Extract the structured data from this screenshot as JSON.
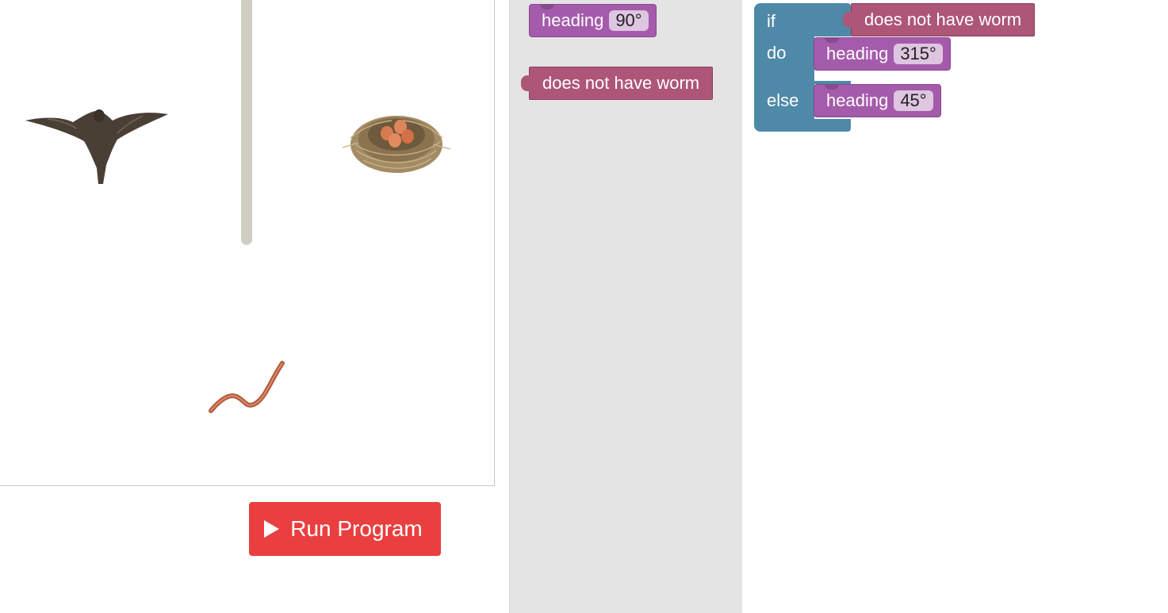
{
  "maze": {
    "bird_icon": "flying-bird",
    "nest_icon": "nest-with-eggs",
    "worm_icon": "worm",
    "wall_color": "#d0cec2"
  },
  "run_button": {
    "label": "Run Program",
    "icon": "play-icon",
    "color": "#ea3f3f"
  },
  "toolbox": {
    "heading_block": {
      "keyword": "heading",
      "value": "90°"
    },
    "condition_block": {
      "label": "does not have worm"
    }
  },
  "workspace": {
    "if_block": {
      "if_label": "if",
      "do_label": "do",
      "else_label": "else",
      "condition": "does not have worm",
      "do_heading": {
        "keyword": "heading",
        "value": "315°"
      },
      "else_heading": {
        "keyword": "heading",
        "value": "45°"
      }
    }
  },
  "colors": {
    "heading_block": "#a55bab",
    "condition_block": "#ad5677",
    "if_block": "#4f89a8",
    "toolbox_bg": "#e4e4e4"
  }
}
